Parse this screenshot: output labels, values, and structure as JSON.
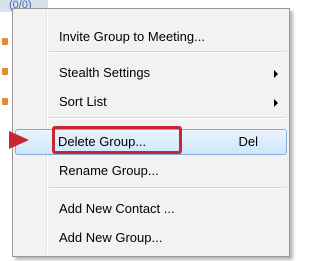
{
  "background": {
    "tab_text": "(0/0)"
  },
  "context_menu": {
    "items": [
      {
        "label": "Invite Group to Meeting..."
      },
      {
        "label": "Stealth Settings"
      },
      {
        "label": "Sort List"
      },
      {
        "label": "Delete Group...",
        "shortcut": "Del",
        "highlighted": true
      },
      {
        "label": "Rename Group..."
      },
      {
        "label": "Add New Contact ..."
      },
      {
        "label": "Add New Group..."
      }
    ]
  },
  "colors": {
    "highlight_border": "#84acd8",
    "callout_red": "#c82630",
    "menu_background": "#f2f2f2"
  },
  "icons": {
    "submenu": "chevron-right-icon",
    "callout": "arrow-right-icon"
  }
}
